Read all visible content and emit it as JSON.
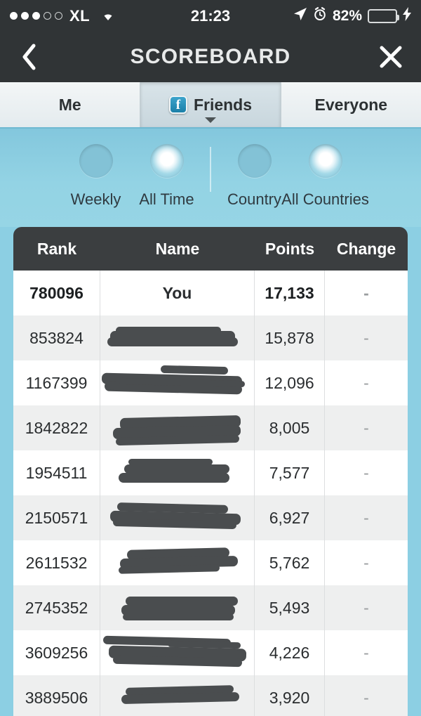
{
  "status_bar": {
    "signal_dots_filled": 3,
    "signal_dots_total": 5,
    "carrier": "XL",
    "wifi_icon": "wifi-icon",
    "time": "21:23",
    "location_icon": "location-arrow-icon",
    "alarm_icon": "alarm-clock-icon",
    "battery_percent": "82%",
    "battery_level": 82,
    "battery_color": "#4cd964",
    "charging_icon": "lightning-bolt-icon"
  },
  "nav": {
    "back_icon": "chevron-left-icon",
    "title": "SCOREBOARD",
    "close_icon": "close-x-icon"
  },
  "tabs": [
    {
      "label": "Me",
      "icon": null,
      "active": false
    },
    {
      "label": "Friends",
      "icon": "facebook-icon",
      "icon_glyph": "f",
      "active": true,
      "caret": "chevron-down-icon"
    },
    {
      "label": "Everyone",
      "icon": null,
      "active": false
    }
  ],
  "filters": {
    "period": [
      {
        "label": "Weekly",
        "selected": false
      },
      {
        "label": "All Time",
        "selected": true
      }
    ],
    "region": [
      {
        "label": "Country",
        "selected": false
      },
      {
        "label": "All Countries",
        "selected": true
      }
    ]
  },
  "table": {
    "columns": [
      "Rank",
      "Name",
      "Points",
      "Change"
    ],
    "rows": [
      {
        "rank": "780096",
        "name": "You",
        "redacted": false,
        "points": "17,133",
        "change": "-",
        "is_self": true
      },
      {
        "rank": "853824",
        "name": "",
        "redacted": true,
        "points": "15,878",
        "change": "-",
        "is_self": false
      },
      {
        "rank": "1167399",
        "name": "",
        "redacted": true,
        "points": "12,096",
        "change": "-",
        "is_self": false
      },
      {
        "rank": "1842822",
        "name": "",
        "redacted": true,
        "points": "8,005",
        "change": "-",
        "is_self": false
      },
      {
        "rank": "1954511",
        "name": "",
        "redacted": true,
        "points": "7,577",
        "change": "-",
        "is_self": false
      },
      {
        "rank": "2150571",
        "name": "",
        "redacted": true,
        "points": "6,927",
        "change": "-",
        "is_self": false
      },
      {
        "rank": "2611532",
        "name": "",
        "redacted": true,
        "points": "5,762",
        "change": "-",
        "is_self": false
      },
      {
        "rank": "2745352",
        "name": "",
        "redacted": true,
        "points": "5,493",
        "change": "-",
        "is_self": false
      },
      {
        "rank": "3609256",
        "name": "",
        "redacted": true,
        "points": "4,226",
        "change": "-",
        "is_self": false
      },
      {
        "rank": "3889506",
        "name": "",
        "redacted": true,
        "points": "3,920",
        "change": "-",
        "is_self": false
      }
    ]
  },
  "colors": {
    "page_background": "#8ccfe3",
    "chrome_dark": "#303436",
    "table_header": "#3b3e40",
    "row_alt": "#eeefef",
    "facebook_blue": "#1a7fa8"
  }
}
